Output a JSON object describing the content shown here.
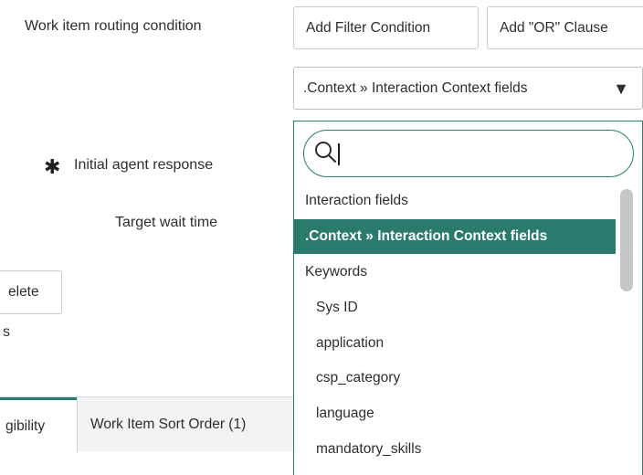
{
  "form": {
    "routing_label": "Work item routing condition",
    "initial_response_label": "Initial agent response",
    "required_marker": "✱",
    "target_wait_label": "Target wait time"
  },
  "buttons": {
    "add_filter": "Add Filter Condition",
    "add_or": "Add \"OR\" Clause",
    "delete_partial": "elete",
    "partial_text": "s"
  },
  "field_select": {
    "value": ".Context » Interaction Context fields",
    "caret": "▼"
  },
  "dropdown": {
    "search_value": "",
    "options": [
      {
        "label": "Interaction fields",
        "level": 1,
        "selected": false
      },
      {
        "label": ".Context » Interaction Context fields",
        "level": 1,
        "selected": true
      },
      {
        "label": "Keywords",
        "level": 1,
        "selected": false
      },
      {
        "label": "Sys ID",
        "level": 2,
        "selected": false
      },
      {
        "label": "application",
        "level": 2,
        "selected": false
      },
      {
        "label": "csp_category",
        "level": 2,
        "selected": false
      },
      {
        "label": "language",
        "level": 2,
        "selected": false
      },
      {
        "label": "mandatory_skills",
        "level": 2,
        "selected": false
      }
    ]
  },
  "tabs": [
    {
      "label": "gibility",
      "active": true
    },
    {
      "label": "Work Item Sort Order (1)",
      "active": false
    }
  ],
  "colors": {
    "accent": "#2b7a6e",
    "border": "#c9cdd2",
    "tab_bg": "#f2f3f4"
  }
}
